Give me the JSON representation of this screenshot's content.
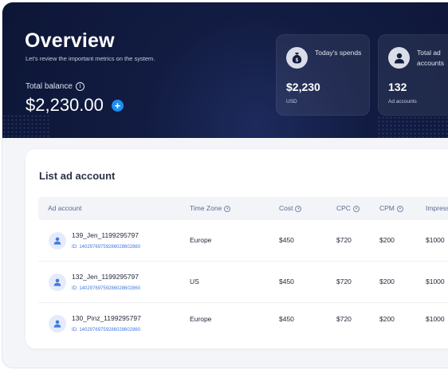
{
  "header": {
    "title": "Overview",
    "subtitle": "Let's review the important metrics on the system.",
    "balance_label": "Total balance",
    "balance_value": "$2,230.00"
  },
  "stats": [
    {
      "label": "Today's spends",
      "value": "$2,230",
      "unit": "USD",
      "icon": "money-bag-icon"
    },
    {
      "label": "Total ad accounts",
      "value": "132",
      "unit": "Ad accounts",
      "icon": "user-icon"
    }
  ],
  "table": {
    "title": "List ad account",
    "columns": [
      "Ad account",
      "Time Zone",
      "Cost",
      "CPC",
      "CPM",
      "Impress"
    ],
    "rows": [
      {
        "name": "139_Jen_1199295797",
        "id": "ID: 1402976975928602860​2860",
        "tz": "Europe",
        "cost": "$450",
        "cpc": "$720",
        "cpm": "$200",
        "imp": "$1000"
      },
      {
        "name": "132_Jen_1199295797",
        "id": "ID: 1402976975928602860​2860",
        "tz": "US",
        "cost": "$450",
        "cpc": "$720",
        "cpm": "$200",
        "imp": "$1000"
      },
      {
        "name": "130_Pinz_1199295797",
        "id": "ID: 1402976975928602860​2860",
        "tz": "Europe",
        "cost": "$450",
        "cpc": "$720",
        "cpm": "$200",
        "imp": "$1000"
      }
    ]
  },
  "colors": {
    "hero_bg": "#0d1636",
    "accent": "#1f8ff0",
    "link": "#3f7be0"
  }
}
